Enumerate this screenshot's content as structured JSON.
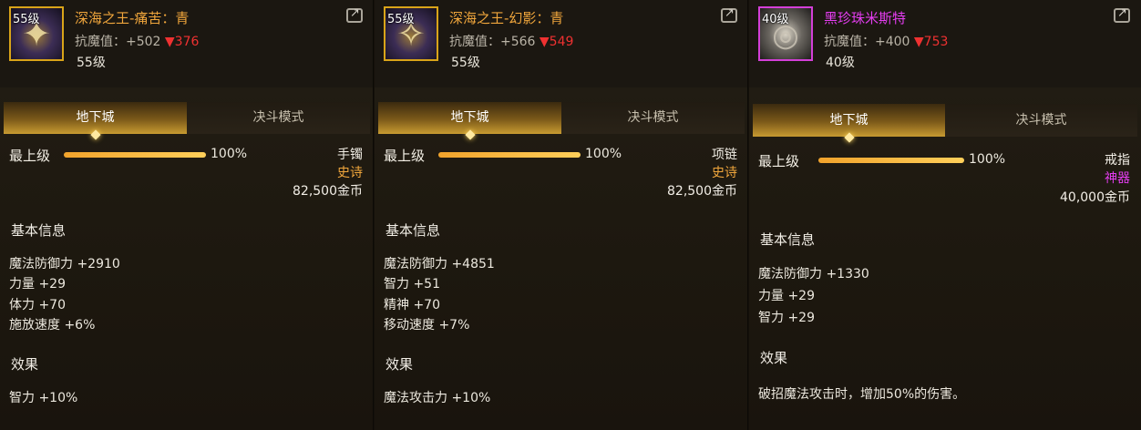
{
  "panels": [
    {
      "icon_level": "55级",
      "icon_name": "gauntlet-icon",
      "name": "深海之王-痛苦：青",
      "resist_label": "抗魔值：",
      "resist_base": "+502",
      "resist_delta": "▼376",
      "level": "55级",
      "tabs": [
        "地下城",
        "决斗模式"
      ],
      "grade_label": "最上级",
      "grade_value": 1.0,
      "percent": "100%",
      "slot": "手镯",
      "rarity": "史诗",
      "price": "82,500金币",
      "basic_title": "基本信息",
      "stats": [
        "魔法防御力 +2910",
        "力量 +29",
        "体力 +70",
        "施放速度 +6%"
      ],
      "effect_title": "效果",
      "effects": [
        "智力 +10%"
      ]
    },
    {
      "icon_level": "55级",
      "icon_name": "necklace-icon",
      "name": "深海之王-幻影：青",
      "resist_label": "抗魔值：",
      "resist_base": "+566",
      "resist_delta": "▼549",
      "level": "55级",
      "tabs": [
        "地下城",
        "决斗模式"
      ],
      "grade_label": "最上级",
      "grade_value": 1.0,
      "percent": "100%",
      "slot": "项链",
      "rarity": "史诗",
      "price": "82,500金币",
      "basic_title": "基本信息",
      "stats": [
        "魔法防御力 +4851",
        "智力 +51",
        "精神 +70",
        "移动速度 +7%"
      ],
      "effect_title": "效果",
      "effects": [
        "魔法攻击力 +10%"
      ]
    },
    {
      "icon_level": "40级",
      "icon_name": "ring-icon",
      "name": "黑珍珠米斯特",
      "resist_label": "抗魔值：",
      "resist_base": "+400",
      "resist_delta": "▼753",
      "level": "40级",
      "tabs": [
        "地下城",
        "决斗模式"
      ],
      "grade_label": "最上级",
      "grade_value": 1.0,
      "percent": "100%",
      "slot": "戒指",
      "rarity": "神器",
      "price": "40,000金币",
      "basic_title": "基本信息",
      "stats": [
        "魔法防御力 +1330",
        "力量 +29",
        "智力 +29"
      ],
      "effect_title": "效果",
      "effects": [
        "破招魔法攻击时，增加50%的伤害。"
      ]
    }
  ],
  "colors": {
    "epic": "#f0a63c",
    "artifact": "#e43df0",
    "resist_down": "#ef3131"
  }
}
